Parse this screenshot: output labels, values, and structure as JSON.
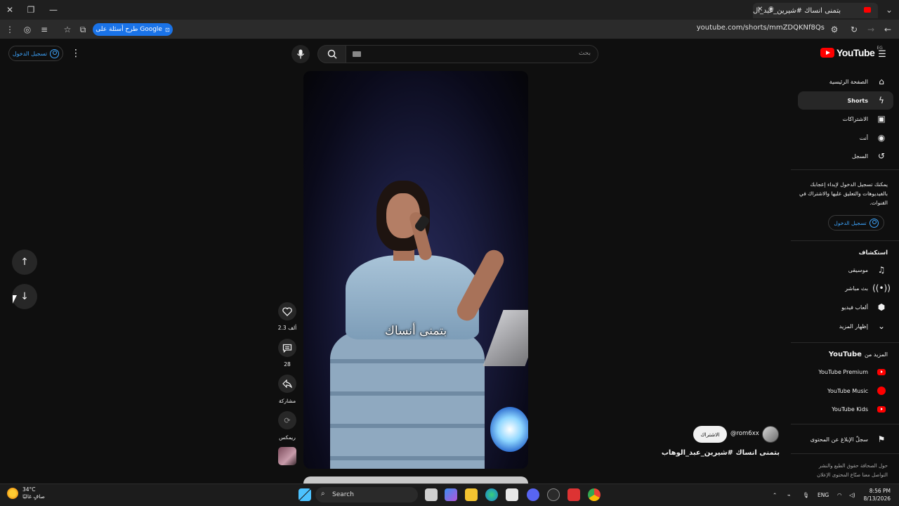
{
  "browser": {
    "tab_title": "بتمنى انساك #شيرين_عبد_ال",
    "url": "youtube.com/shorts/mmZDQKNf8Qs",
    "google_pill": "طرح أسئلة على Google"
  },
  "header": {
    "signin_label": "تسجيل الدخول",
    "search_placeholder": "بحث",
    "logo_text": "YouTube",
    "logo_region": "EG"
  },
  "sidebar": {
    "items": [
      {
        "label": "الصفحة الرئيسية",
        "icon": "home-icon"
      },
      {
        "label": "Shorts",
        "icon": "shorts-icon",
        "active": true
      },
      {
        "label": "الاشتراكات",
        "icon": "subscriptions-icon"
      },
      {
        "label": "أنت",
        "icon": "you-icon"
      },
      {
        "label": "السجل",
        "icon": "history-icon"
      }
    ],
    "signin_note": "يمكنك تسجيل الدخول لإبداء إعجابك بالفيديوهات والتعليق عليها والاشتراك في القنوات.",
    "signin_button": "تسجيل الدخول",
    "explore_title": "استكشاف",
    "explore_items": [
      {
        "label": "موسيقى",
        "icon": "music-icon"
      },
      {
        "label": "بث مباشر",
        "icon": "live-icon"
      },
      {
        "label": "ألعاب فيديو",
        "icon": "gaming-icon"
      },
      {
        "label": "إظهار المزيد",
        "icon": "chevron-down-icon"
      }
    ],
    "more_title_prefix": "المزيد من",
    "more_title_brand": "YouTube",
    "more_items": [
      {
        "label": "YouTube Premium"
      },
      {
        "label": "YouTube Music"
      },
      {
        "label": "YouTube Kids"
      }
    ],
    "report_label": "سجلّ الإبلاغ عن المحتوى",
    "footer_links": "حول  الصحافة  حقوق الطبع والنشر  التواصل معنا  صنّاع المحتوى  الإعلان"
  },
  "video": {
    "caption": "بتمنى أنساك",
    "title": "بتمنى انساك #شيرين_عبد_الوهاب",
    "channel": "@rom6xx",
    "subscribe_label": "الاشتراك"
  },
  "actions": {
    "likes": "2.3 ألف",
    "comments": "28",
    "share": "مشاركة",
    "remix": "ريمكس"
  },
  "taskbar": {
    "weather_temp": "34°C",
    "weather_desc": "صافٍ غالبًا",
    "search": "Search",
    "lang": "ENG",
    "time": "8:56 PM",
    "date": "8/13/2026"
  }
}
